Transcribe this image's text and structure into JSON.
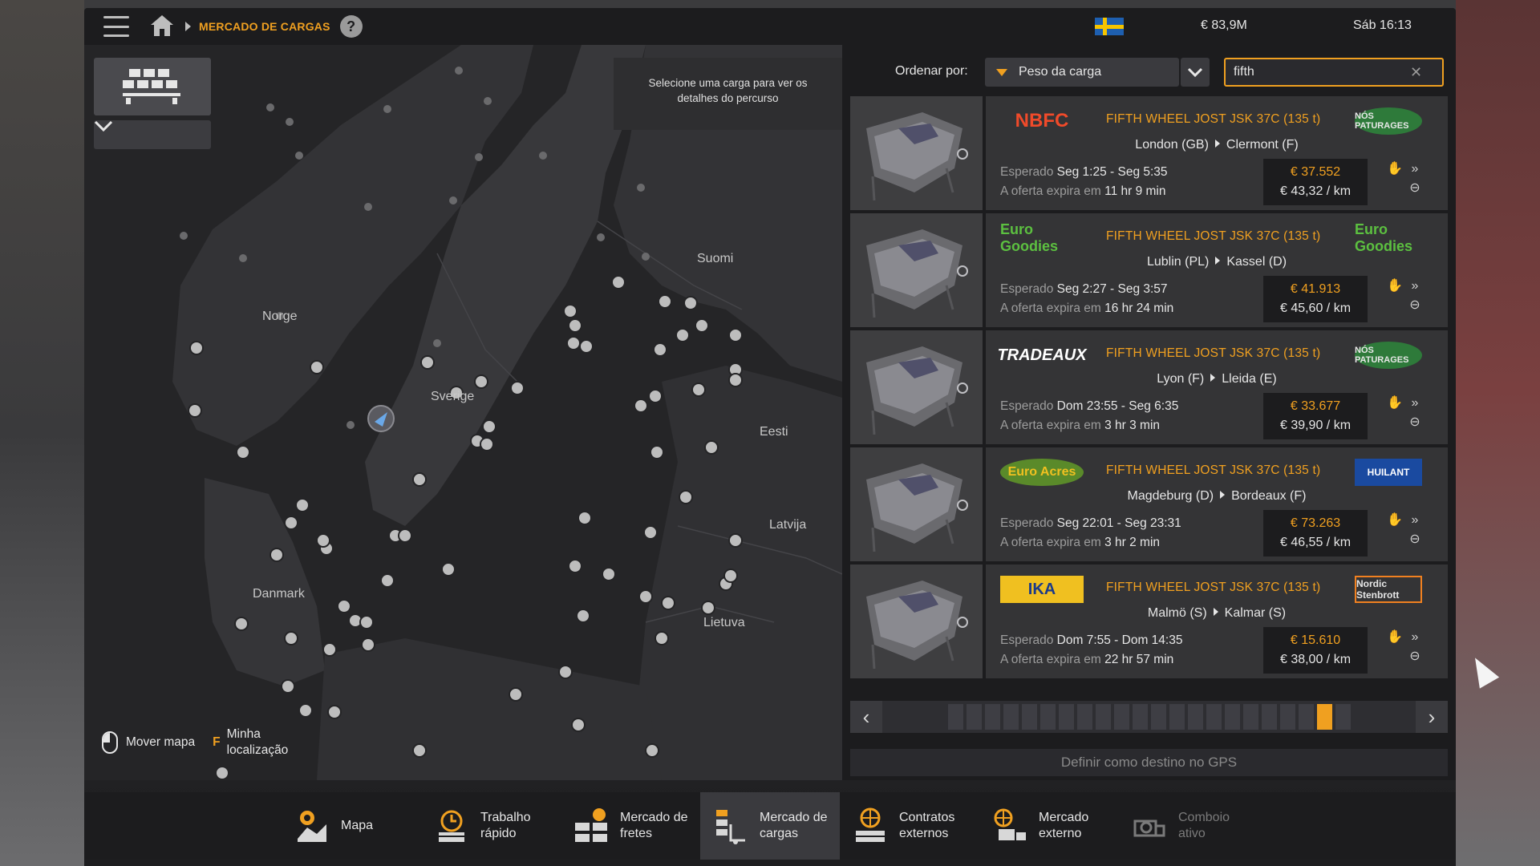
{
  "header": {
    "breadcrumb": "MERCADO DE CARGAS",
    "help": "?",
    "money": "€ 83,9M",
    "clock": "Sáb 16:13",
    "flag_colors": [
      "#1e5fb0",
      "#f5c400"
    ]
  },
  "map": {
    "hint": "Selecione uma carga para ver os detalhes do percurso",
    "labels": {
      "norge": "Norge",
      "sverige": "Sverige",
      "suomi": "Suomi",
      "eesti": "Eesti",
      "latvija": "Latvija",
      "danmark": "Danmark",
      "lietuva": "Lietuva"
    },
    "controls": {
      "move_map": "Mover mapa",
      "key": "F",
      "my_location_1": "Minha",
      "my_location_2": "localização"
    }
  },
  "sort": {
    "label": "Ordenar por:",
    "selected": "Peso da carga"
  },
  "search": {
    "value": "fifth",
    "clear": "✕"
  },
  "cards": [
    {
      "left_logo": "NBFC",
      "right_logo": "NÓS PATURAGES",
      "cargo": "FIFTH WHEEL JOST JSK 37C (135 t)",
      "origin": "London (GB)",
      "destination": "Clermont (F)",
      "expected_label": "Esperado",
      "expected": "Seg 1:25 - Seg 5:35",
      "expires_label": "A oferta expira em",
      "expires": "11 hr 9 min",
      "price": "€ 37.552",
      "per_km": "€ 43,32 / km"
    },
    {
      "left_logo": "Euro Goodies",
      "right_logo": "Euro Goodies",
      "cargo": "FIFTH WHEEL JOST JSK 37C (135 t)",
      "origin": "Lublin (PL)",
      "destination": "Kassel (D)",
      "expected_label": "Esperado",
      "expected": "Seg 2:27 - Seg 3:57",
      "expires_label": "A oferta expira em",
      "expires": "16 hr 24 min",
      "price": "€ 41.913",
      "per_km": "€ 45,60 / km"
    },
    {
      "left_logo": "TRADEAUX",
      "right_logo": "NÓS PATURAGES",
      "cargo": "FIFTH WHEEL JOST JSK 37C (135 t)",
      "origin": "Lyon (F)",
      "destination": "Lleida (E)",
      "expected_label": "Esperado",
      "expected": "Dom 23:55 - Seg 6:35",
      "expires_label": "A oferta expira em",
      "expires": "3 hr 3 min",
      "price": "€ 33.677",
      "per_km": "€ 39,90 / km"
    },
    {
      "left_logo": "Euro Acres",
      "right_logo": "HUILANT",
      "cargo": "FIFTH WHEEL JOST JSK 37C (135 t)",
      "origin": "Magdeburg (D)",
      "destination": "Bordeaux (F)",
      "expected_label": "Esperado",
      "expected": "Seg 22:01 - Seg 23:31",
      "expires_label": "A oferta expira em",
      "expires": "3 hr 2 min",
      "price": "€ 73.263",
      "per_km": "€ 46,55 / km"
    },
    {
      "left_logo": "IKA",
      "right_logo": "Nordic Stenbrott",
      "cargo": "FIFTH WHEEL JOST JSK 37C (135 t)",
      "origin": "Malmö (S)",
      "destination": "Kalmar (S)",
      "expected_label": "Esperado",
      "expected": "Dom 7:55 - Dom 14:35",
      "expires_label": "A oferta expira em",
      "expires": "22 hr 57 min",
      "price": "€ 15.610",
      "per_km": "€ 38,00 / km"
    }
  ],
  "pager": {
    "total_pages": 22,
    "active_page": 21
  },
  "gps_button": "Definir como destino no GPS",
  "nav": [
    {
      "line1": "Mapa",
      "line2": "",
      "icon": "map-pin-icon"
    },
    {
      "line1": "Trabalho",
      "line2": "rápido",
      "icon": "stopwatch-icon"
    },
    {
      "line1": "Mercado de",
      "line2": "fretes",
      "icon": "freight-icon"
    },
    {
      "line1": "Mercado de",
      "line2": "cargas",
      "icon": "cargo-icon"
    },
    {
      "line1": "Contratos",
      "line2": "externos",
      "icon": "globe-icon"
    },
    {
      "line1": "Mercado",
      "line2": "externo",
      "icon": "globe-truck-icon"
    },
    {
      "line1": "Comboio",
      "line2": "ativo",
      "icon": "convoy-icon"
    }
  ],
  "colors": {
    "accent": "#f0a020",
    "panel": "#1c1c1e",
    "card": "#343436"
  }
}
